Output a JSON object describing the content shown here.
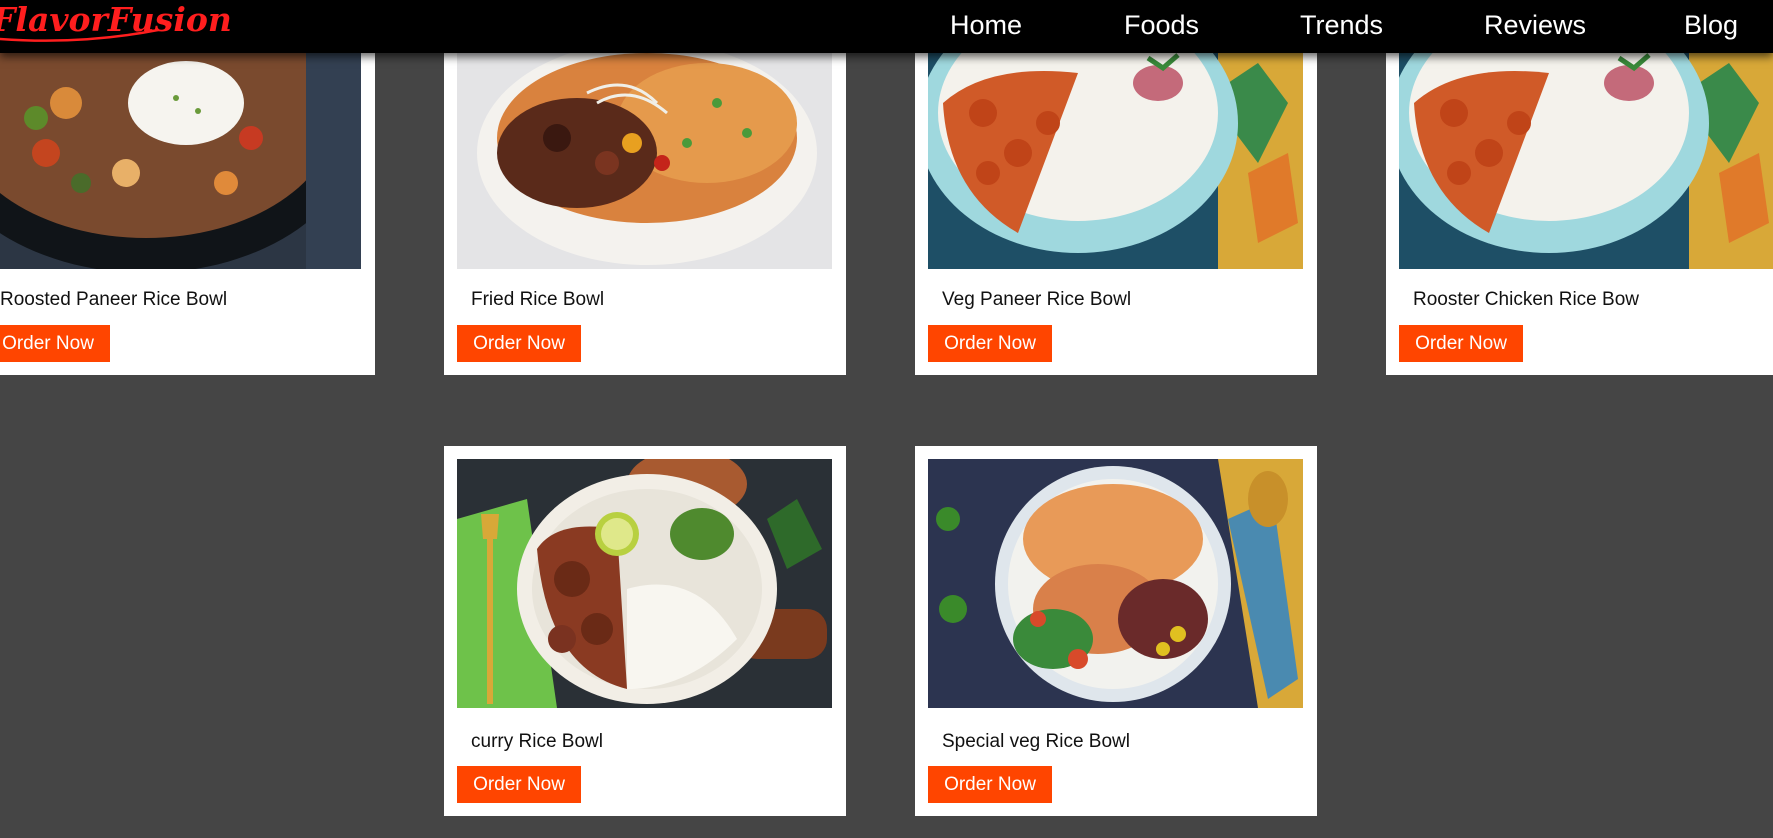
{
  "brand": {
    "logo_text": "FlavorFusion",
    "logo_color": "#ff1e1e"
  },
  "nav": {
    "items": [
      {
        "label": "Home"
      },
      {
        "label": "Foods"
      },
      {
        "label": "Trends"
      },
      {
        "label": "Reviews"
      },
      {
        "label": "Blog"
      }
    ]
  },
  "colors": {
    "page_bg": "#454545",
    "nav_bg": "#000000",
    "card_bg": "#ffffff",
    "button_bg": "#ff4500",
    "button_text": "#ffffff"
  },
  "products": [
    {
      "name": "Roosted Paneer Rice Bowl",
      "button": "Order Now",
      "image": "black bowl of rice with paneer, beans and sour cream"
    },
    {
      "name": "Fried Rice Bowl",
      "button": "Order Now",
      "image": "white bowl of fried rice with chilli paneer"
    },
    {
      "name": "Veg Paneer Rice Bowl",
      "button": "Order Now",
      "image": "blue bowl with paneer curry and white rice"
    },
    {
      "name": "Rooster Chicken Rice Bow",
      "button": "Order Now",
      "image": "blue bowl with chicken curry and white rice"
    },
    {
      "name": "curry Rice Bowl",
      "button": "Order Now",
      "image": "white bowl with mutton curry, rice, lime and green chutney"
    },
    {
      "name": "Special veg Rice Bowl",
      "button": "Order Now",
      "image": "white bowl with veg curry, rice, beans and vegetables"
    }
  ]
}
